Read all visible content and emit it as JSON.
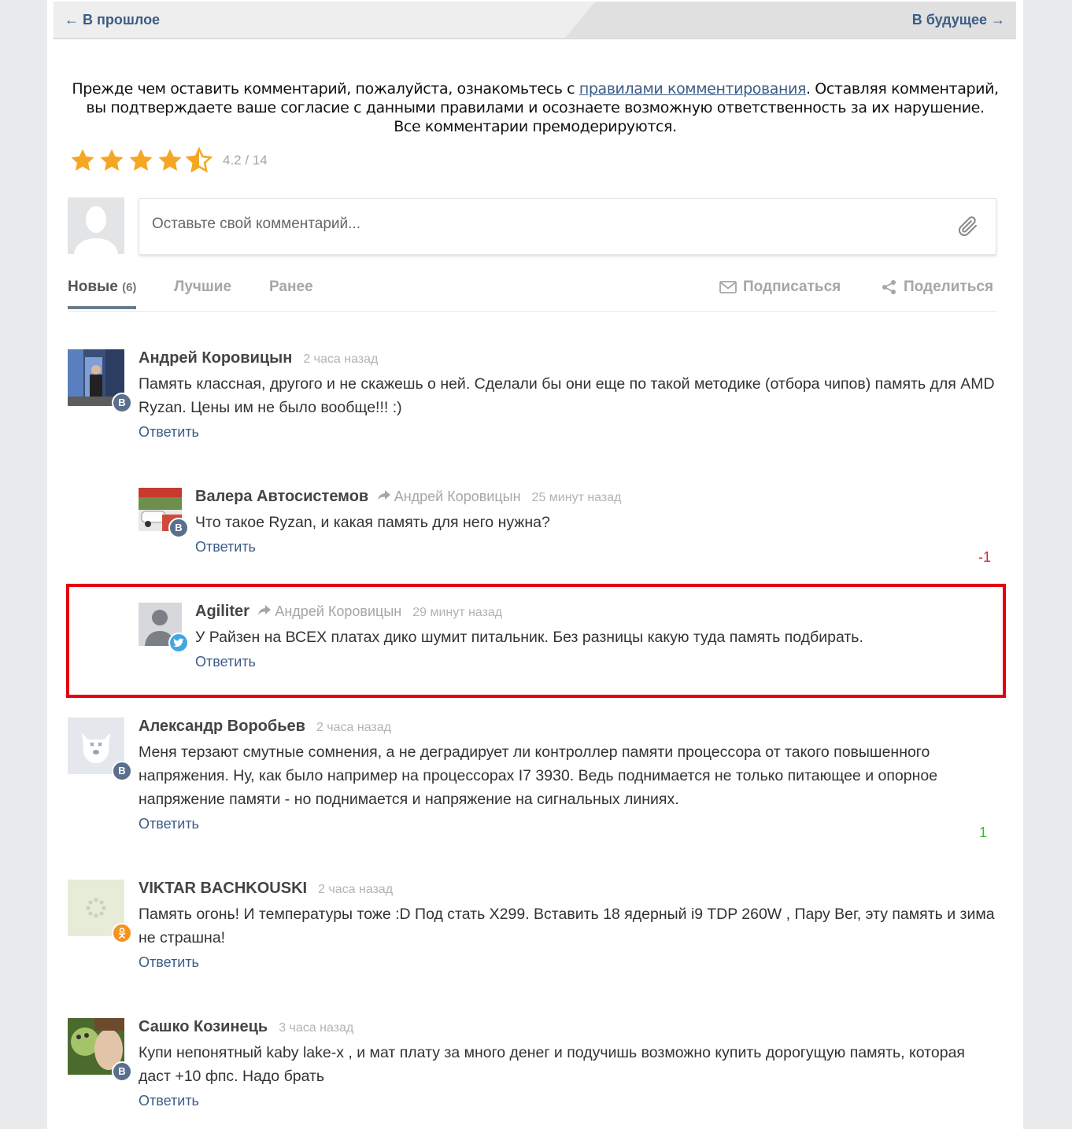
{
  "nav": {
    "prev": "← В прошлое",
    "next": "В будущее →"
  },
  "notice": {
    "before_link": "Прежде чем оставить комментарий, пожалуйста, ознакомьтесь с ",
    "link": "правилами комментирования",
    "after_link": ". Оставляя комментарий, вы подтверждаете ваше согласие с данными правилами и осознаете возможную ответственность за их нарушение.",
    "line2": "Все комментарии премодерируются."
  },
  "rating": {
    "value_text": "4.2 / 14",
    "value": 4.2,
    "max_stars": 5,
    "star_color": "#f5a623"
  },
  "comment_input": {
    "placeholder": "Оставьте свой комментарий..."
  },
  "tabs": {
    "new_label": "Новые",
    "new_count": "(6)",
    "best_label": "Лучшие",
    "earlier_label": "Ранее",
    "subscribe": "Подписаться",
    "share": "Поделиться"
  },
  "reply_label": "Ответить",
  "comments": [
    {
      "author": "Андрей Коровицын",
      "reply_to": "",
      "time": "2 часа назад",
      "text": "Память классная, другого и не скажешь о ней. Сделали бы они еще по такой методике (отбора чипов) память для AMD Ryzan. Цены им не было вообще!!! :)",
      "network": "vk",
      "badge": "В",
      "vote": ""
    },
    {
      "author": "Валера Автосистемов",
      "reply_to": "Андрей Коровицын",
      "time": "25 минут назад",
      "text": "Что такое Ryzan, и какая память для него нужна?",
      "network": "vk",
      "badge": "В",
      "vote": "-1"
    },
    {
      "author": "Agiliter",
      "reply_to": "Андрей Коровицын",
      "time": "29 минут назад",
      "text": "У Райзен на ВСЕХ платах дико шумит питальник. Без разницы какую туда память подбирать.",
      "network": "twitter",
      "badge": "",
      "vote": ""
    },
    {
      "author": "Александр Воробьев",
      "reply_to": "",
      "time": "2 часа назад",
      "text": "Меня терзают смутные сомнения, а не деградирует ли контроллер памяти процессора от такого повышенного напряжения. Ну, как было например на процессорах I7 3930. Ведь поднимается не только питающее и опорное напряжение памяти - но поднимается и напряжение на сигнальных линиях.",
      "network": "vk",
      "badge": "В",
      "vote": "1"
    },
    {
      "author": "VIKTAR BACHKOUSKI",
      "reply_to": "",
      "time": "2 часа назад",
      "text": "Память огонь! И температуры тоже :D Под стать X299. Вставить  18 ядерный i9 TDP 260W , Пару Вег, эту память и зима не страшна!",
      "network": "ok",
      "badge": "",
      "vote": ""
    },
    {
      "author": "Сашко Козинець",
      "reply_to": "",
      "time": "3 часа назад",
      "text": "Купи непонятный kaby lake-x , и мат плату за много денег и подучишь возможно купить дорогущую память, которая даст +10 фпс. Надо брать",
      "network": "vk",
      "badge": "В",
      "vote": ""
    }
  ],
  "colors": {
    "link": "#3b5c86",
    "negative_vote": "#d0282c",
    "positive_vote": "#2fc12f",
    "highlight_border": "#e5000f"
  }
}
